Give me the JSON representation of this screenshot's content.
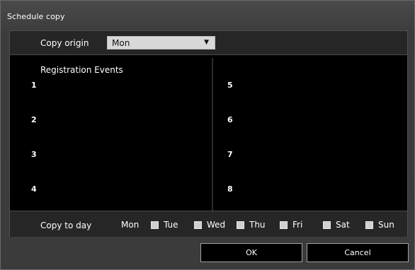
{
  "dialog": {
    "title": "Schedule copy"
  },
  "origin": {
    "label": "Copy origin",
    "selected": "Mon"
  },
  "events": {
    "heading": "Registration Events",
    "left": [
      "1",
      "2",
      "3",
      "4"
    ],
    "right": [
      "5",
      "6",
      "7",
      "8"
    ]
  },
  "copy_to_day": {
    "label": "Copy to day",
    "source_day": "Mon",
    "days": [
      "Tue",
      "Wed",
      "Thu",
      "Fri",
      "Sat",
      "Sun"
    ]
  },
  "buttons": {
    "ok": "OK",
    "cancel": "Cancel"
  }
}
